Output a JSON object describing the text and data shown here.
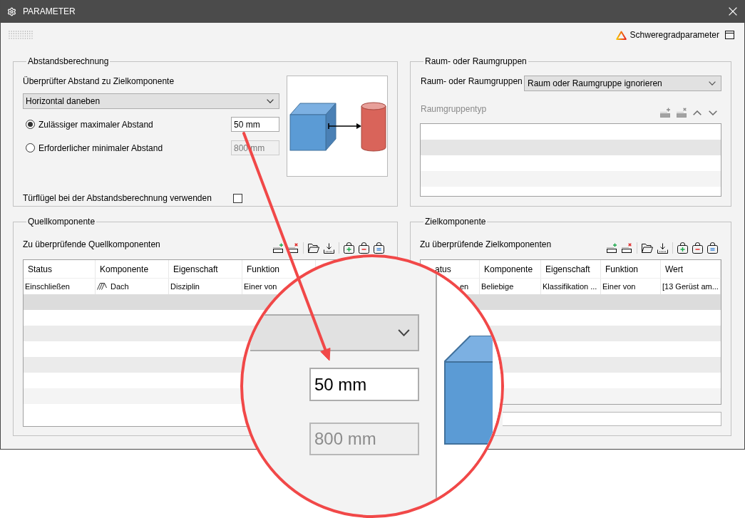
{
  "window": {
    "title": "PARAMETER"
  },
  "toolbar": {
    "severity_button": "Schweregradparameter"
  },
  "distance_group": {
    "title": "Abstandsberechnung",
    "label": "Überprüfter Abstand zu Zielkomponente",
    "dropdown": "Horizontal daneben",
    "options": [
      {
        "label": "Zulässiger maximaler Abstand",
        "selected": true,
        "value": "50 mm",
        "disabled": false
      },
      {
        "label": "Erforderlicher minimaler Abstand",
        "selected": false,
        "value": "800 mm",
        "disabled": true
      }
    ],
    "door_checkbox": {
      "label": "Türflügel bei der Abstandsberechnung verwenden",
      "checked": false
    }
  },
  "room_group": {
    "title": "Raum- oder Raumgruppen",
    "label": "Raum- oder Raumgruppen",
    "dropdown": "Raum oder Raumgruppe ignorieren",
    "list_label": "Raumgruppentyp",
    "list_disabled": true
  },
  "source_group": {
    "title": "Quellkomponente",
    "label": "Zu überprüfende Quellkomponenten",
    "table": {
      "columns": [
        "Status",
        "Komponente",
        "Eigenschaft",
        "Funktion"
      ],
      "rows": [
        {
          "cells": [
            {
              "text": "Einschließen",
              "icon": false
            },
            {
              "text": "Dach",
              "icon": true
            },
            {
              "text": "Disziplin",
              "icon": false
            },
            {
              "text": "Einer von",
              "icon": false
            }
          ]
        }
      ]
    }
  },
  "target_group": {
    "title": "Zielkomponente",
    "label": "Zu überprüfende Zielkomponenten",
    "table": {
      "columns": [
        "atus",
        "Komponente",
        "Eigenschaft",
        "Funktion",
        "Wert"
      ],
      "rows": [
        {
          "cells": [
            {
              "text": "en",
              "icon": false
            },
            {
              "text": "Beliebige",
              "icon": false
            },
            {
              "text": "Klassifikation ...",
              "icon": false
            },
            {
              "text": "Einer von",
              "icon": false
            },
            {
              "text": "[13 Gerüst am...",
              "icon": false
            }
          ]
        }
      ]
    }
  },
  "magnifier": {
    "value_field": "50 mm",
    "disabled_field": "800 mm"
  }
}
